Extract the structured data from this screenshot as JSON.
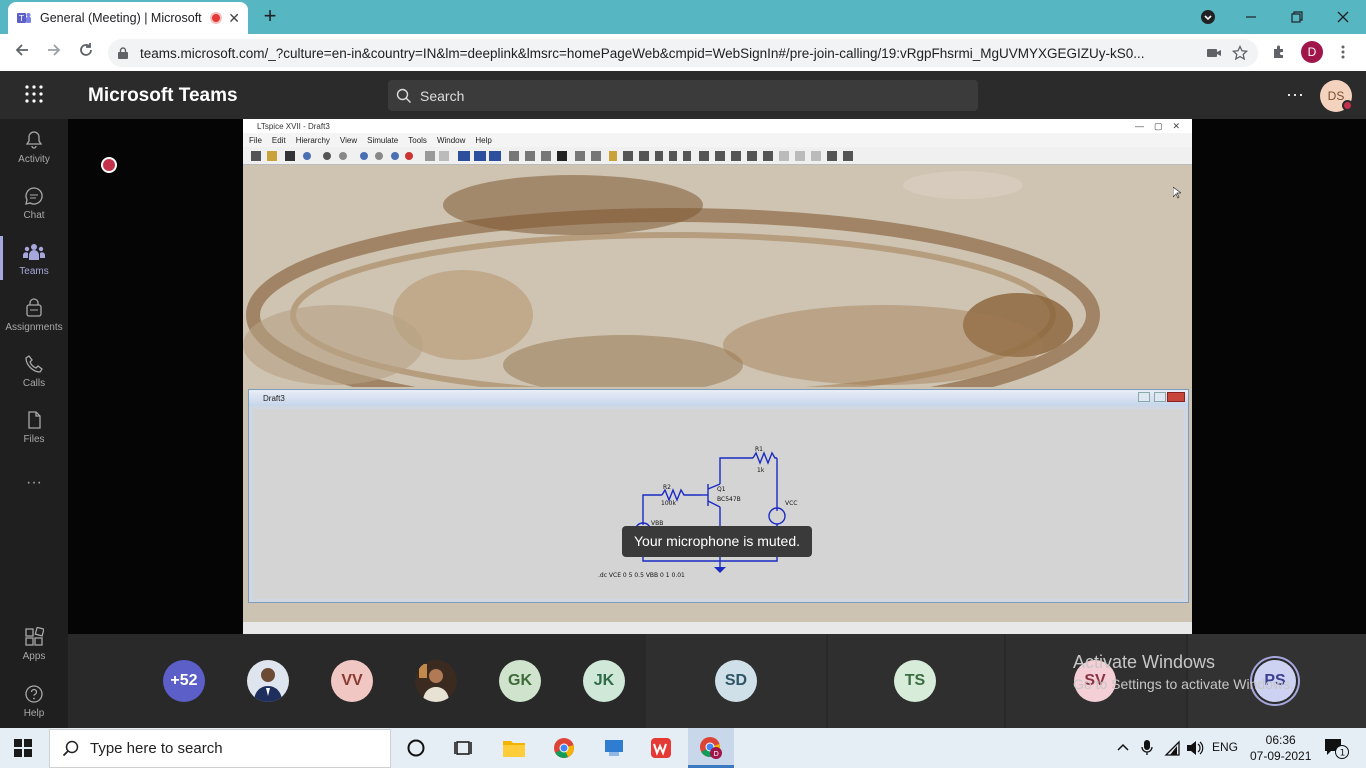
{
  "browser": {
    "tab_title": "General (Meeting) | Microsoft",
    "tab_close": "✕",
    "new_tab": "+",
    "url": "teams.microsoft.com/_?culture=en-in&country=IN&lm=deeplink&lmsrc=homePageWeb&cmpid=WebSignIn#/pre-join-calling/19:vRgpFhsrmi_MgUVMYXGEGIZUy-kS0...",
    "profile_initial": "D"
  },
  "teams": {
    "app_title": "Microsoft Teams",
    "search_placeholder": "Search",
    "user_initials": "DS",
    "more": "···"
  },
  "rail": [
    {
      "label": "Activity"
    },
    {
      "label": "Chat"
    },
    {
      "label": "Teams"
    },
    {
      "label": "Assignments"
    },
    {
      "label": "Calls"
    },
    {
      "label": "Files"
    },
    {
      "label": "···"
    },
    {
      "label": "Apps"
    },
    {
      "label": "Help"
    }
  ],
  "shared_screen": {
    "window_title": "LTspice XVII - Draft3",
    "menu": [
      "File",
      "Edit",
      "Hierarchy",
      "View",
      "Simulate",
      "Tools",
      "Window",
      "Help"
    ],
    "sub_window_title": "Draft3",
    "components": {
      "r1": "R1",
      "r1_val": "1k",
      "r2": "R2",
      "r2_val": "100k",
      "q1": "Q1",
      "q1_val": "BC547B",
      "vcc": "VCC",
      "vbb": "VBB",
      "directive": ".dc VCE 0 5 0.5 VBB 0 1 0.01"
    }
  },
  "toast": {
    "text": "Your microphone is muted."
  },
  "participants": [
    {
      "initials": "+52",
      "bg": "#5b5fc7",
      "fg": "#ffffff"
    },
    {
      "initials": "",
      "bg": "#6c7a90",
      "fg": "#ffffff",
      "photo": true
    },
    {
      "initials": "VV",
      "bg": "#f1c7c3",
      "fg": "#8a3a33"
    },
    {
      "initials": "",
      "bg": "#7a4a2a",
      "fg": "#ffffff",
      "photo": true
    },
    {
      "initials": "GK",
      "bg": "#cfe3cd",
      "fg": "#3f6b3c"
    },
    {
      "initials": "JK",
      "bg": "#cfe8d8",
      "fg": "#2e6b47"
    },
    {
      "initials": "SD",
      "bg": "#cfe0e8",
      "fg": "#2e5566"
    },
    {
      "initials": "TS",
      "bg": "#d7ecd9",
      "fg": "#3a6d42"
    },
    {
      "initials": "SV",
      "bg": "#f5cfd6",
      "fg": "#8a3446"
    },
    {
      "initials": "PS",
      "bg": "#cdd2f3",
      "fg": "#3b3f8f"
    }
  ],
  "watermark": {
    "line1": "Activate Windows",
    "line2": "Go to Settings to activate Windows."
  },
  "taskbar": {
    "search_placeholder": "Type here to search",
    "language": "ENG",
    "time": "06:36",
    "date": "07-09-2021",
    "notifications": "1"
  }
}
